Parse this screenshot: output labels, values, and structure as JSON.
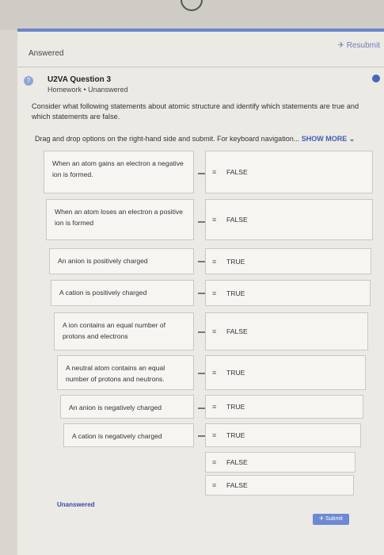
{
  "header": {
    "status": "Answered",
    "resubmit_label": "Resubmit"
  },
  "question": {
    "title": "U2VA Question 3",
    "subtitle": "Homework • Unanswered",
    "prompt": "Consider what following statements about atomic structure and identify which statements are true and which statements are false.",
    "instruction": "Drag and drop options on the right-hand side and submit. For keyboard navigation...",
    "show_more": "SHOW MORE"
  },
  "statements": [
    "When an atom gains an electron a negative ion is formed.",
    "When an atom loses an electron a positive ion is formed",
    "An anion is positively charged",
    "A cation is positively charged",
    "A ion contains an equal number of protons and electrons",
    "A neutral atom contains an equal number of protons and neutrons.",
    "An anion is negatively charged",
    "A cation is negatively charged"
  ],
  "answers": [
    "FALSE",
    "FALSE",
    "TRUE",
    "TRUE",
    "FALSE",
    "TRUE",
    "TRUE",
    "TRUE"
  ],
  "spare_options": [
    "FALSE",
    "FALSE"
  ],
  "footer": {
    "status": "Unanswered",
    "submit_label": "Submit"
  },
  "icons": {
    "resubmit": "send-icon",
    "grip": "drag-handle-icon",
    "question": "question-icon"
  },
  "colors": {
    "accent": "#4a67b8",
    "card_border": "#6d86c9"
  }
}
